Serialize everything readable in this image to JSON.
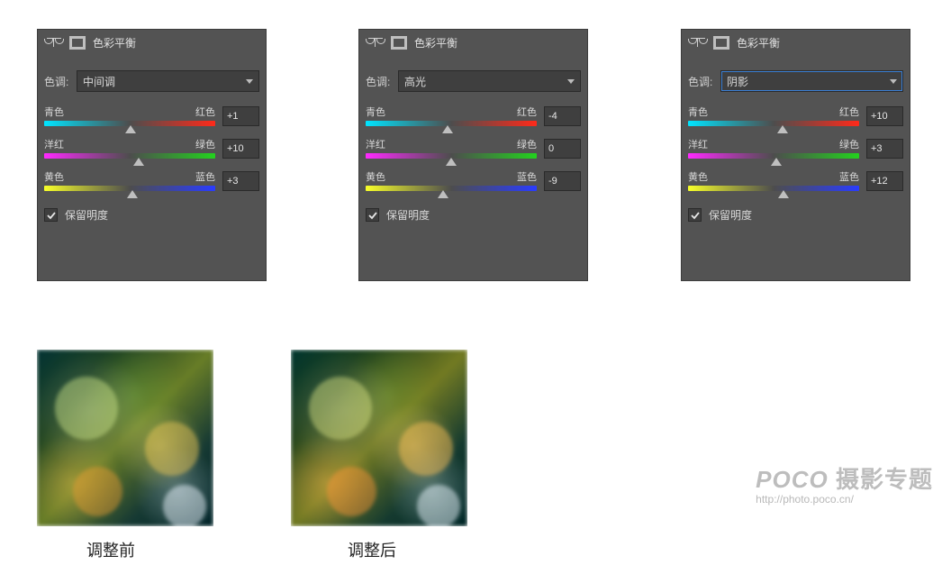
{
  "labels": {
    "panel_title": "色彩平衡",
    "tone_label": "色调:",
    "cyan": "青色",
    "red": "红色",
    "magenta": "洋红",
    "green": "绿色",
    "yellow": "黄色",
    "blue": "蓝色",
    "preserve_luminosity": "保留明度"
  },
  "panels": [
    {
      "id": "midtones",
      "tone_value": "中间调",
      "highlighted_select": false,
      "sliders": {
        "cyan_red": {
          "value": "+1",
          "pos": 50.5
        },
        "magenta_green": {
          "value": "+10",
          "pos": 55
        },
        "yellow_blue": {
          "value": "+3",
          "pos": 51.5
        }
      },
      "preserve_luminosity_checked": true
    },
    {
      "id": "highlights",
      "tone_value": "高光",
      "highlighted_select": false,
      "sliders": {
        "cyan_red": {
          "value": "-4",
          "pos": 48
        },
        "magenta_green": {
          "value": "0",
          "pos": 50
        },
        "yellow_blue": {
          "value": "-9",
          "pos": 45.5
        }
      },
      "preserve_luminosity_checked": true
    },
    {
      "id": "shadows",
      "tone_value": "阴影",
      "highlighted_select": true,
      "sliders": {
        "cyan_red": {
          "value": "+10",
          "pos": 55
        },
        "magenta_green": {
          "value": "+3",
          "pos": 51.5
        },
        "yellow_blue": {
          "value": "+12",
          "pos": 56
        }
      },
      "preserve_luminosity_checked": true
    }
  ],
  "captions": {
    "before": "调整前",
    "after": "调整后"
  },
  "watermark": {
    "brand": "POCO",
    "suffix": "摄影专题",
    "url": "http://photo.poco.cn/"
  }
}
